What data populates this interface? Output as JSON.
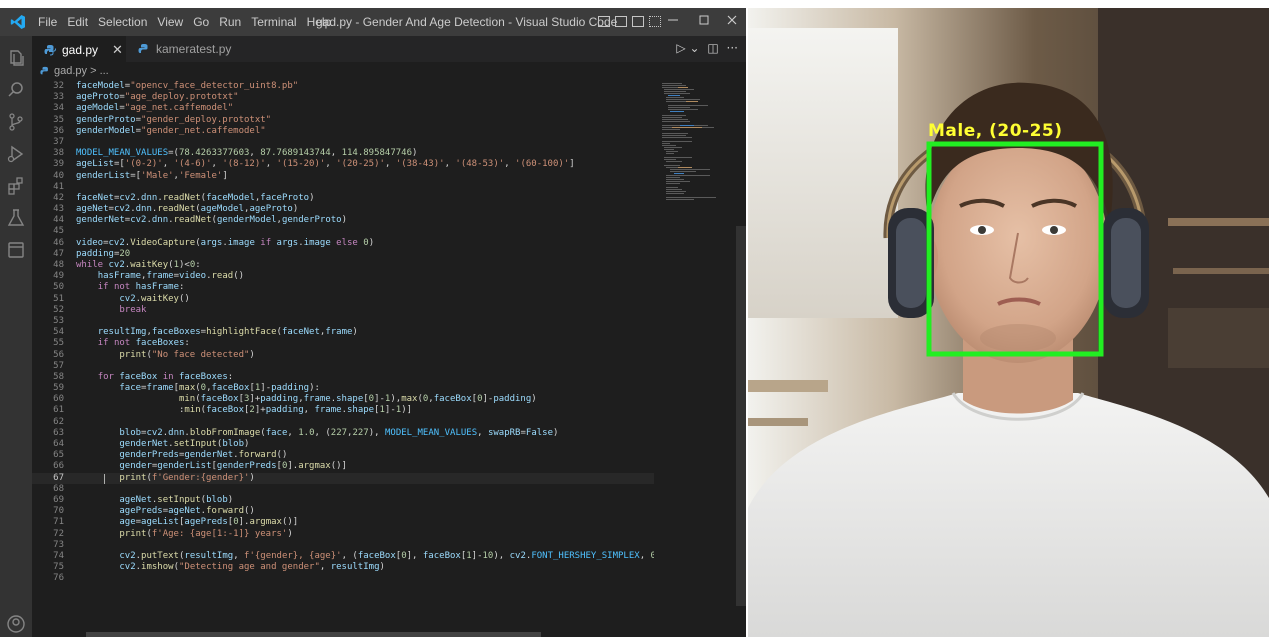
{
  "window": {
    "title": "gad.py - Gender And Age Detection - Visual Studio Code",
    "menu": [
      "File",
      "Edit",
      "Selection",
      "View",
      "Go",
      "Run",
      "Terminal",
      "Help"
    ]
  },
  "tabs": [
    {
      "label": "gad.py",
      "active": true
    },
    {
      "label": "kameratest.py",
      "active": false
    }
  ],
  "breadcrumb": "gad.py > ...",
  "code_lines": [
    {
      "n": "32",
      "text": "faceModel=\"opencv_face_detector_uint8.pb\""
    },
    {
      "n": "33",
      "text": "ageProto=\"age_deploy.prototxt\""
    },
    {
      "n": "34",
      "text": "ageModel=\"age_net.caffemodel\""
    },
    {
      "n": "35",
      "text": "genderProto=\"gender_deploy.prototxt\""
    },
    {
      "n": "36",
      "text": "genderModel=\"gender_net.caffemodel\""
    },
    {
      "n": "37",
      "text": ""
    },
    {
      "n": "38",
      "text": "MODEL_MEAN_VALUES=(78.4263377603, 87.7689143744, 114.895847746)"
    },
    {
      "n": "39",
      "text": "ageList=['(0-2)', '(4-6)', '(8-12)', '(15-20)', '(20-25)', '(38-43)', '(48-53)', '(60-100)']"
    },
    {
      "n": "40",
      "text": "genderList=['Male','Female']"
    },
    {
      "n": "41",
      "text": ""
    },
    {
      "n": "42",
      "text": "faceNet=cv2.dnn.readNet(faceModel,faceProto)"
    },
    {
      "n": "43",
      "text": "ageNet=cv2.dnn.readNet(ageModel,ageProto)"
    },
    {
      "n": "44",
      "text": "genderNet=cv2.dnn.readNet(genderModel,genderProto)"
    },
    {
      "n": "45",
      "text": ""
    },
    {
      "n": "46",
      "text": "video=cv2.VideoCapture(args.image if args.image else 0)"
    },
    {
      "n": "47",
      "text": "padding=20"
    },
    {
      "n": "48",
      "text": "while cv2.waitKey(1)<0:"
    },
    {
      "n": "49",
      "text": "    hasFrame,frame=video.read()"
    },
    {
      "n": "50",
      "text": "    if not hasFrame:"
    },
    {
      "n": "51",
      "text": "        cv2.waitKey()"
    },
    {
      "n": "52",
      "text": "        break"
    },
    {
      "n": "53",
      "text": ""
    },
    {
      "n": "54",
      "text": "    resultImg,faceBoxes=highlightFace(faceNet,frame)"
    },
    {
      "n": "55",
      "text": "    if not faceBoxes:"
    },
    {
      "n": "56",
      "text": "        print(\"No face detected\")"
    },
    {
      "n": "57",
      "text": ""
    },
    {
      "n": "58",
      "text": "    for faceBox in faceBoxes:"
    },
    {
      "n": "59",
      "text": "        face=frame[max(0,faceBox[1]-padding):"
    },
    {
      "n": "60",
      "text": "                   min(faceBox[3]+padding,frame.shape[0]-1),max(0,faceBox[0]-padding)"
    },
    {
      "n": "61",
      "text": "                   :min(faceBox[2]+padding, frame.shape[1]-1)]"
    },
    {
      "n": "62",
      "text": ""
    },
    {
      "n": "63",
      "text": "        blob=cv2.dnn.blobFromImage(face, 1.0, (227,227), MODEL_MEAN_VALUES, swapRB=False)"
    },
    {
      "n": "64",
      "text": "        genderNet.setInput(blob)"
    },
    {
      "n": "65",
      "text": "        genderPreds=genderNet.forward()"
    },
    {
      "n": "66",
      "text": "        gender=genderList[genderPreds[0].argmax()]"
    },
    {
      "n": "67",
      "text": "        print(f'Gender:{gender}')"
    },
    {
      "n": "68",
      "text": ""
    },
    {
      "n": "69",
      "text": "        ageNet.setInput(blob)"
    },
    {
      "n": "70",
      "text": "        agePreds=ageNet.forward()"
    },
    {
      "n": "71",
      "text": "        age=ageList[agePreds[0].argmax()]"
    },
    {
      "n": "72",
      "text": "        print(f'Age: {age[1:-1]} years')"
    },
    {
      "n": "73",
      "text": ""
    },
    {
      "n": "74",
      "text": "        cv2.putText(resultImg, f'{gender}, {age}', (faceBox[0], faceBox[1]-10), cv2.FONT_HERSHEY_SIMPLEX, 0.8, (0"
    },
    {
      "n": "75",
      "text": "        cv2.imshow(\"Detecting age and gender\", resultImg)"
    },
    {
      "n": "76",
      "text": ""
    }
  ],
  "current_line": "67",
  "camera": {
    "label": "Male, (20-25)",
    "box_color": "#22ee22",
    "label_color": "#ffff33"
  },
  "colors": {
    "keyword": "#c586c0",
    "string": "#ce9178",
    "number": "#b5cea8",
    "variable": "#9cdcfe",
    "function": "#dcdcaa",
    "constant": "#4fc1ff"
  }
}
